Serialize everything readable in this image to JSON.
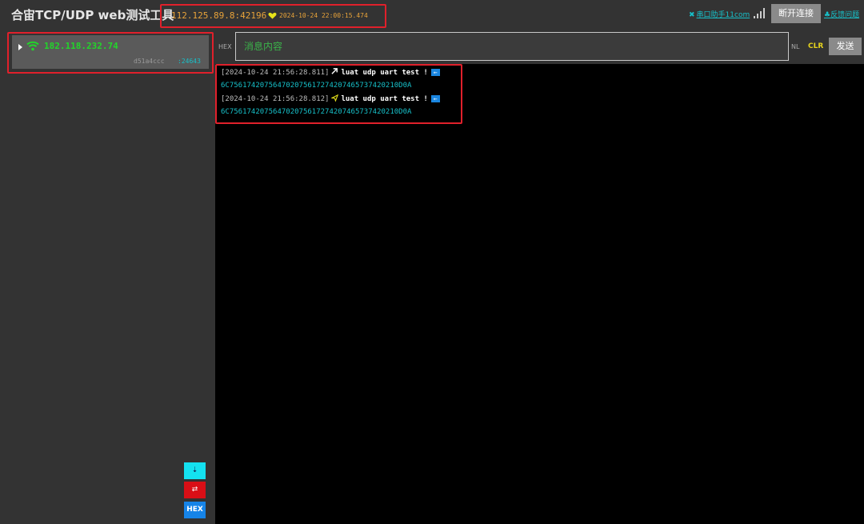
{
  "header": {
    "title": "合宙TCP/UDP web测试工具",
    "server_addr": "112.125.89.8:42196",
    "server_time": "2024-10-24 22:00:15.474",
    "serial_link": "串口助手11com",
    "disconnect_label": "断开连接",
    "feedback_label": "反馈问题"
  },
  "sidebar": {
    "client": {
      "ip": "182.118.232.74",
      "id": "d51a4ccc",
      "port": ":24643"
    },
    "buttons": {
      "scroll": "⇣",
      "swap": "⇄",
      "hex": "HEX"
    }
  },
  "input_row": {
    "hex_label": "HEX",
    "placeholder": "消息内容",
    "nl_label": "NL",
    "clr_label": "CLR",
    "send_label": "发送"
  },
  "log": [
    {
      "time": "[2024-10-24 21:56:28.811]",
      "direction": "receive",
      "text": "luat udp uart test !",
      "hex": "6C756174207564702075617274207465737420210D0A"
    },
    {
      "time": "[2024-10-24 21:56:28.812]",
      "direction": "send",
      "text": "luat udp uart test !",
      "hex": "6C756174207564702075617274207465737420210D0A"
    }
  ],
  "colors": {
    "accent": "#17c0c9",
    "highlight": "#e0202b",
    "client_ip": "#22d62a",
    "server": "#e8a33a"
  }
}
